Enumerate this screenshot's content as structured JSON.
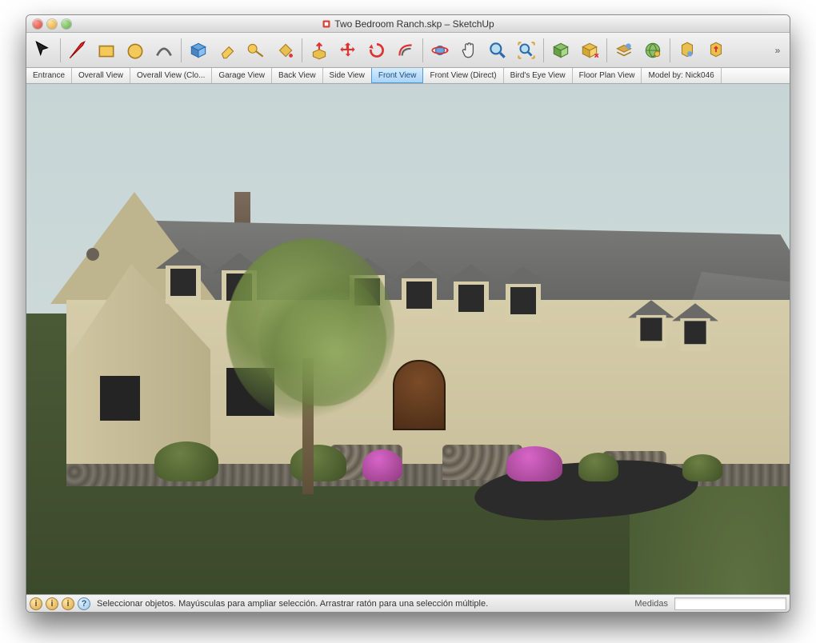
{
  "window": {
    "title": "Two Bedroom Ranch.skp – SketchUp"
  },
  "toolbar": {
    "tools": [
      {
        "name": "select-tool",
        "label": "Select"
      },
      {
        "name": "line-tool",
        "label": "Line"
      },
      {
        "name": "rectangle-tool",
        "label": "Rectangle"
      },
      {
        "name": "circle-tool",
        "label": "Circle"
      },
      {
        "name": "arc-tool",
        "label": "Arc"
      },
      {
        "name": "make-component-tool",
        "label": "Make Component"
      },
      {
        "name": "eraser-tool",
        "label": "Eraser"
      },
      {
        "name": "tape-measure-tool",
        "label": "Tape Measure"
      },
      {
        "name": "paint-bucket-tool",
        "label": "Paint Bucket"
      },
      {
        "name": "push-pull-tool",
        "label": "Push/Pull"
      },
      {
        "name": "move-tool",
        "label": "Move"
      },
      {
        "name": "rotate-tool",
        "label": "Rotate"
      },
      {
        "name": "offset-tool",
        "label": "Offset"
      },
      {
        "name": "orbit-tool",
        "label": "Orbit"
      },
      {
        "name": "pan-tool",
        "label": "Pan"
      },
      {
        "name": "zoom-tool",
        "label": "Zoom"
      },
      {
        "name": "zoom-extents-tool",
        "label": "Zoom Extents"
      },
      {
        "name": "add-location-tool",
        "label": "Add Location"
      },
      {
        "name": "get-models-tool",
        "label": "Get Models"
      },
      {
        "name": "layers-tool",
        "label": "Layers"
      },
      {
        "name": "outliner-tool",
        "label": "Outliner"
      },
      {
        "name": "scenes-tool",
        "label": "Scenes"
      },
      {
        "name": "shadows-tool",
        "label": "Shadows"
      }
    ]
  },
  "scenes": {
    "active_index": 6,
    "items": [
      {
        "label": "Entrance"
      },
      {
        "label": "Overall View"
      },
      {
        "label": "Overall View (Clo..."
      },
      {
        "label": "Garage View"
      },
      {
        "label": "Back View"
      },
      {
        "label": "Side View"
      },
      {
        "label": "Front View"
      },
      {
        "label": "Front View (Direct)"
      },
      {
        "label": "Bird's Eye View"
      },
      {
        "label": "Floor Plan View"
      },
      {
        "label": "Model by: Nick046"
      }
    ]
  },
  "status": {
    "hint": "Seleccionar objetos. Mayúsculas para ampliar selección. Arrastrar ratón para una selección múltiple.",
    "measurements_label": "Medidas",
    "measurements_value": ""
  }
}
